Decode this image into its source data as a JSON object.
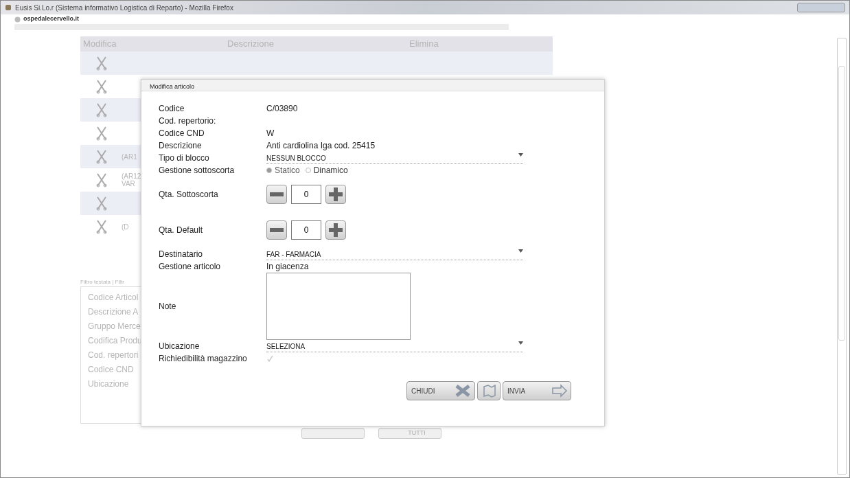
{
  "window": {
    "title": "Eusis Si.Lo.r (Sistema informativo Logistica di Reparto) - Mozilla Firefox"
  },
  "address_bar": {
    "url": "ospedalecervello.it"
  },
  "list": {
    "columns": [
      "Modifica",
      "Descrizione",
      "Elimina"
    ],
    "rows": [
      {
        "kind": "edit"
      },
      {
        "kind": "edit"
      },
      {
        "kind": "edit"
      },
      {
        "kind": "edit"
      },
      {
        "kind": "edit",
        "lines": [
          "(AR1"
        ]
      },
      {
        "kind": "edit",
        "lines": [
          "(AR12",
          "VAR"
        ]
      },
      {
        "kind": "edit"
      },
      {
        "kind": "edit",
        "lines": [
          "(D"
        ]
      }
    ]
  },
  "filter": {
    "tabs": "Filtro testata | Filtr",
    "fields": [
      "Codice Articol",
      "Descrizione A",
      "Gruppo Merce",
      "Codifica Produ",
      "Cod. repertori",
      "Codice CND",
      "Ubicazione"
    ],
    "buttons": [
      "TUTTI"
    ]
  },
  "modal": {
    "title": "Modifica articolo",
    "fields": [
      {
        "kind": "text",
        "label": "Codice",
        "value": "C/03890"
      },
      {
        "kind": "text",
        "label": "Cod. repertorio:"
      },
      {
        "kind": "text",
        "label": "Codice CND",
        "value": "W"
      },
      {
        "kind": "text",
        "label": "Descrizione",
        "value": "Anti cardiolina Iga cod. 25415"
      },
      {
        "kind": "select",
        "label": "Tipo di blocco",
        "value": "NESSUN BLOCCO"
      },
      {
        "kind": "radio",
        "label": "Gestione sottoscorta",
        "options": [
          {
            "label": "Statico",
            "selected": true
          },
          {
            "label": "Dinamico",
            "selected": false
          }
        ]
      },
      {
        "kind": "stepper",
        "label": "Qta. Sottoscorta",
        "value": "0"
      },
      {
        "kind": "stepper",
        "label": "Qta. Default",
        "value": "0"
      },
      {
        "kind": "select",
        "label": "Destinatario",
        "value": "FAR - FARMACIA"
      },
      {
        "kind": "text",
        "label": "Gestione articolo",
        "value": "In giacenza"
      },
      {
        "kind": "textarea",
        "label": "Note"
      },
      {
        "kind": "select",
        "label": "Ubicazione",
        "value": "SELEZIONA"
      },
      {
        "kind": "checkbox",
        "label": "Richiedibilità magazzino",
        "checked": true
      }
    ],
    "buttons": [
      {
        "kind": "close",
        "label": "CHIUDI"
      },
      {
        "kind": "map"
      },
      {
        "kind": "send",
        "label": "INVIA"
      }
    ]
  }
}
